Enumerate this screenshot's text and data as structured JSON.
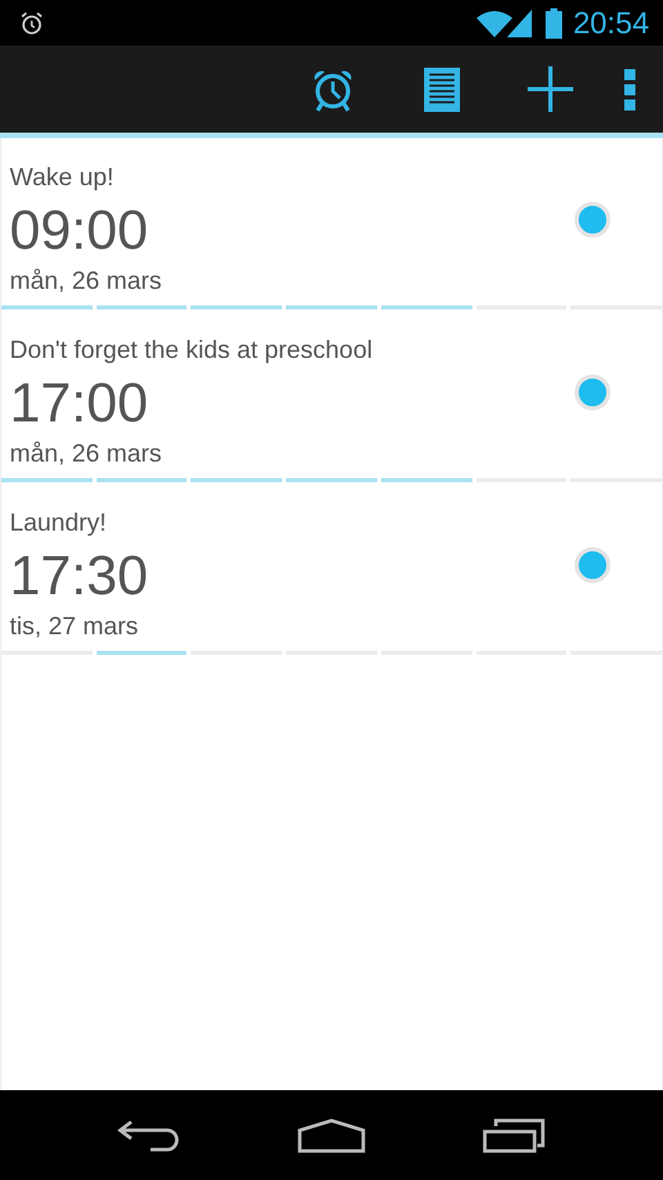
{
  "status_bar": {
    "time": "20:54"
  },
  "alarms": [
    {
      "title": "Wake up!",
      "time": "09:00",
      "date": "mån, 26 mars",
      "enabled": true,
      "days": [
        true,
        true,
        true,
        true,
        true,
        false,
        false
      ]
    },
    {
      "title": "Don't forget the kids at preschool",
      "time": "17:00",
      "date": "mån, 26 mars",
      "enabled": true,
      "days": [
        true,
        true,
        true,
        true,
        true,
        false,
        false
      ]
    },
    {
      "title": "Laundry!",
      "time": "17:30",
      "date": "tis, 27 mars",
      "enabled": true,
      "days": [
        false,
        true,
        false,
        false,
        false,
        false,
        false
      ]
    }
  ]
}
